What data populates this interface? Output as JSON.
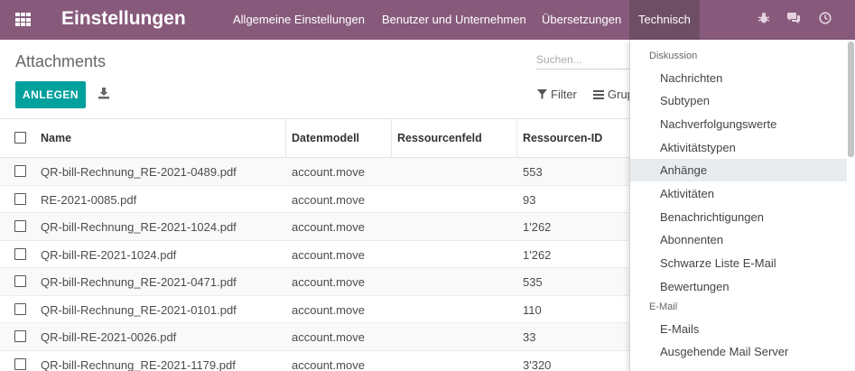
{
  "navbar": {
    "brand": "Einstellungen",
    "menu": [
      "Allgemeine Einstellungen",
      "Benutzer und Unternehmen",
      "Übersetzungen",
      "Technisch"
    ],
    "active_menu": "Technisch",
    "color": "#875a7b"
  },
  "control": {
    "breadcrumb": "Attachments",
    "create_label": "ANLEGEN",
    "search_placeholder": "Suchen...",
    "filter_label": "Filter",
    "group_label": "Grup",
    "accent": "#00a09d"
  },
  "table": {
    "columns": [
      "Name",
      "Datenmodell",
      "Ressourcenfeld",
      "Ressourcen-ID"
    ],
    "rows": [
      {
        "name": "QR-bill-Rechnung_RE-2021-0489.pdf",
        "model": "account.move",
        "field": "",
        "id": "553"
      },
      {
        "name": "RE-2021-0085.pdf",
        "model": "account.move",
        "field": "",
        "id": "93"
      },
      {
        "name": "QR-bill-Rechnung_RE-2021-1024.pdf",
        "model": "account.move",
        "field": "",
        "id": "1'262"
      },
      {
        "name": "QR-bill-RE-2021-1024.pdf",
        "model": "account.move",
        "field": "",
        "id": "1'262"
      },
      {
        "name": "QR-bill-Rechnung_RE-2021-0471.pdf",
        "model": "account.move",
        "field": "",
        "id": "535"
      },
      {
        "name": "QR-bill-Rechnung_RE-2021-0101.pdf",
        "model": "account.move",
        "field": "",
        "id": "110"
      },
      {
        "name": "QR-bill-RE-2021-0026.pdf",
        "model": "account.move",
        "field": "",
        "id": "33"
      },
      {
        "name": "QR-bill-Rechnung_RE-2021-1179.pdf",
        "model": "account.move",
        "field": "",
        "id": "3'320"
      }
    ]
  },
  "dropdown": {
    "section1": "Diskussion",
    "items1": [
      "Nachrichten",
      "Subtypen",
      "Nachverfolgungswerte",
      "Aktivitätstypen",
      "Anhänge",
      "Aktivitäten",
      "Benachrichtigungen",
      "Abonnenten",
      "Schwarze Liste E-Mail",
      "Bewertungen"
    ],
    "active_item": "Anhänge",
    "section2": "E-Mail",
    "items2": [
      "E-Mails",
      "Ausgehende Mail Server"
    ]
  },
  "icons": {
    "apps": "grid-icon",
    "debug": "bug-icon",
    "chat": "chat-icon",
    "activity": "clock-icon",
    "download": "download-icon",
    "filter": "filter-icon",
    "group": "list-icon"
  }
}
